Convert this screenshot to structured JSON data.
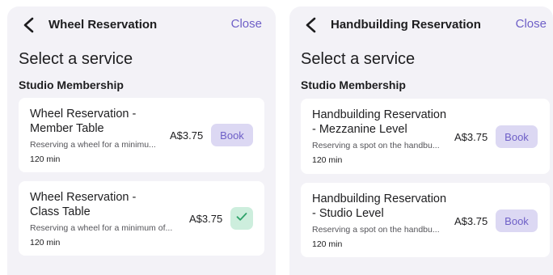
{
  "panels": [
    {
      "header_title": "Wheel Reservation",
      "close_label": "Close",
      "page_title": "Select a service",
      "section_title": "Studio Membership",
      "services": [
        {
          "name": "Wheel Reservation - Member Table",
          "description": "Reserving a wheel for a minimu...",
          "duration": "120 min",
          "price": "A$3.75",
          "action": "Book"
        },
        {
          "name": "Wheel Reservation - Class Table",
          "description": "Reserving a wheel for a minimum of...",
          "duration": "120 min",
          "price": "A$3.75",
          "action": "selected"
        }
      ]
    },
    {
      "header_title": "Handbuilding Reservation",
      "close_label": "Close",
      "page_title": "Select a service",
      "section_title": "Studio Membership",
      "services": [
        {
          "name": "Handbuilding Reservation - Mezzanine Level",
          "description": "Reserving a spot on the handbu...",
          "duration": "120 min",
          "price": "A$3.75",
          "action": "Book"
        },
        {
          "name": "Handbuilding Reservation - Studio Level",
          "description": "Reserving a spot on the handbu...",
          "duration": "120 min",
          "price": "A$3.75",
          "action": "Book"
        }
      ]
    }
  ],
  "colors": {
    "accent": "#6e5fc7",
    "book_button_bg": "#dcd8f3",
    "selected_bg": "#cdeedd",
    "selected_check": "#2fa36b",
    "panel_bg": "#f3f2f7"
  },
  "icons": {
    "back": "chevron-left-icon",
    "selected": "checkmark-icon"
  }
}
